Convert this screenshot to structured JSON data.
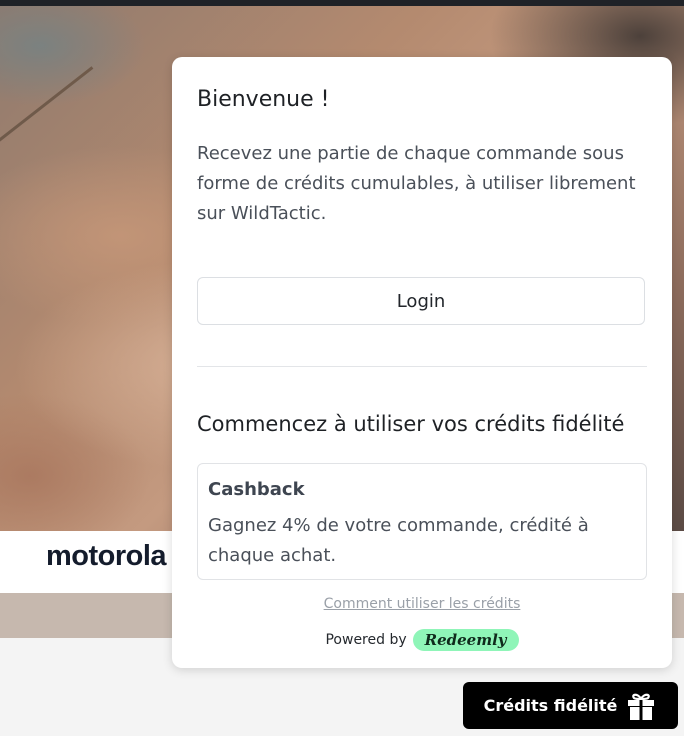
{
  "background": {
    "brand_logo": "motorola"
  },
  "modal": {
    "title": "Bienvenue !",
    "description": "Recevez une partie de chaque commande sous forme de crédits cumulables, à utiliser librement sur WildTactic.",
    "login_label": "Login",
    "section_title": "Commencez à utiliser vos crédits fidélité",
    "cashback": {
      "title": "Cashback",
      "description": "Gagnez 4% de votre commande, crédité à chaque achat."
    },
    "help_link": "Comment utiliser les crédits",
    "powered_by": "Powered by",
    "provider_logo": "Redeemly"
  },
  "launcher": {
    "label": "Crédits fidélité",
    "icon": "gift-icon"
  },
  "colors": {
    "modal_bg": "#ffffff",
    "launcher_bg": "#000000",
    "provider_accent": "#8ff5b8"
  }
}
